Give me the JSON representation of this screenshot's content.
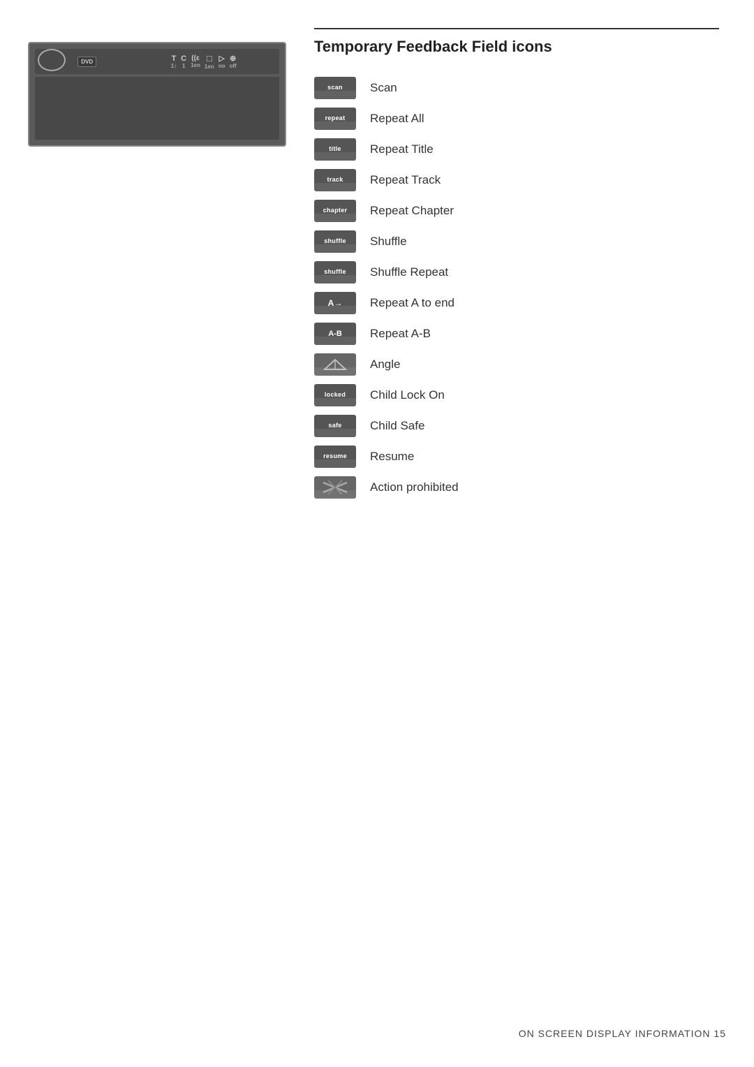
{
  "left_panel": {
    "display_label": "DVD",
    "icons": [
      "T",
      "C",
      "((ε",
      "□",
      "▷",
      "⊕"
    ],
    "values": [
      "1↕",
      "1",
      "1en",
      "1en",
      "no",
      "off"
    ]
  },
  "right_panel": {
    "title": "Temporary Feedback Field icons",
    "items": [
      {
        "badge_top": "scan",
        "badge_sub": "",
        "label": "Scan"
      },
      {
        "badge_top": "repeat",
        "badge_sub": "",
        "label": "Repeat All"
      },
      {
        "badge_top": "title",
        "badge_sub": "",
        "label": "Repeat Title"
      },
      {
        "badge_top": "track",
        "badge_sub": "",
        "label": "Repeat Track"
      },
      {
        "badge_top": "chapter",
        "badge_sub": "",
        "label": "Repeat Chapter"
      },
      {
        "badge_top": "shuffle",
        "badge_sub": "",
        "label": "Shuffle"
      },
      {
        "badge_top": "shuffle",
        "badge_sub": "",
        "label": "Shuffle Repeat"
      },
      {
        "badge_top": "A→",
        "badge_sub": "",
        "label": "Repeat A to end"
      },
      {
        "badge_top": "A-B",
        "badge_sub": "",
        "label": "Repeat A-B"
      },
      {
        "badge_top": "",
        "badge_sub": "",
        "label": "Angle",
        "type": "angle"
      },
      {
        "badge_top": "locked",
        "badge_sub": "",
        "label": "Child Lock On"
      },
      {
        "badge_top": "safe",
        "badge_sub": "",
        "label": "Child Safe"
      },
      {
        "badge_top": "resume",
        "badge_sub": "",
        "label": "Resume"
      },
      {
        "badge_top": "",
        "badge_sub": "",
        "label": "Action prohibited",
        "type": "prohibited"
      }
    ]
  },
  "footer": {
    "text": "ON SCREEN DISPLAY INFORMATION 15"
  }
}
